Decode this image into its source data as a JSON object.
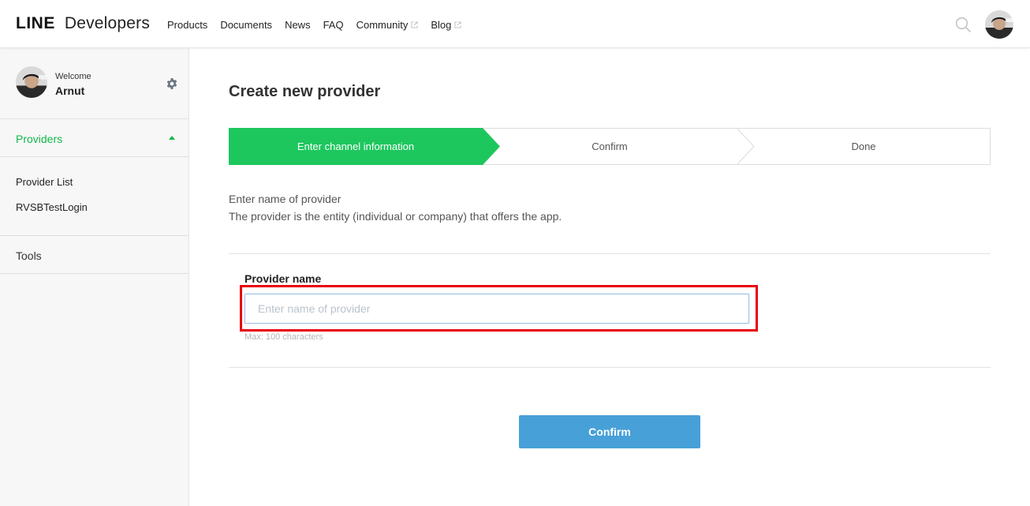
{
  "header": {
    "logo_line": "LINE",
    "logo_dev": "Developers",
    "nav": [
      {
        "label": "Products",
        "external": false
      },
      {
        "label": "Documents",
        "external": false
      },
      {
        "label": "News",
        "external": false
      },
      {
        "label": "FAQ",
        "external": false
      },
      {
        "label": "Community",
        "external": true
      },
      {
        "label": "Blog",
        "external": true
      }
    ],
    "search_icon": "search-icon",
    "avatar_icon": "user-avatar"
  },
  "sidebar": {
    "welcome": "Welcome",
    "username": "Arnut",
    "settings_icon": "gear-icon",
    "providers_label": "Providers",
    "providers_items": [
      "Provider List",
      "RVSBTestLogin"
    ],
    "tools_label": "Tools"
  },
  "main": {
    "title": "Create new provider",
    "steps": [
      "Enter channel information",
      "Confirm",
      "Done"
    ],
    "active_step": 0,
    "desc_line1": "Enter name of provider",
    "desc_line2": "The provider is the entity (individual or company) that offers the app.",
    "field_label": "Provider name",
    "field_placeholder": "Enter name of provider",
    "field_value": "",
    "field_hint": "Max: 100 characters",
    "confirm_label": "Confirm"
  },
  "colors": {
    "accent_green": "#1ec75e",
    "nav_active_green": "#11b84a",
    "button_blue": "#47a0d8",
    "highlight_red": "#e8000b"
  }
}
